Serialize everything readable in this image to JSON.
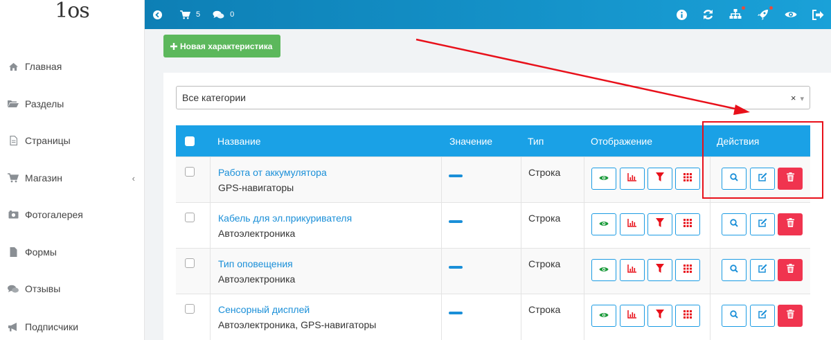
{
  "logo": {
    "text": "1os"
  },
  "sidebar": {
    "items": [
      {
        "label": "Главная",
        "icon": "home-icon"
      },
      {
        "label": "Разделы",
        "icon": "folder-open-icon"
      },
      {
        "label": "Страницы",
        "icon": "file-icon"
      },
      {
        "label": "Магазин",
        "icon": "cart-icon"
      },
      {
        "label": "Фотогалерея",
        "icon": "camera-icon"
      },
      {
        "label": "Формы",
        "icon": "file-solid-icon"
      },
      {
        "label": "Отзывы",
        "icon": "comments-icon"
      },
      {
        "label": "Подписчики",
        "icon": "bullhorn-icon"
      }
    ],
    "shop_chevron": "‹"
  },
  "topbar": {
    "cart_count": "5",
    "comments_count": "0"
  },
  "toolbar": {
    "new_button_label": "Новая характеристика"
  },
  "filter": {
    "selected": "Все категории",
    "clear": "×",
    "caret": "▾"
  },
  "table": {
    "headers": {
      "name": "Название",
      "value": "Значение",
      "type": "Тип",
      "display": "Отображение",
      "actions": "Действия"
    },
    "rows": [
      {
        "name": "Работа от аккумулятора",
        "category": "GPS-навигаторы",
        "type": "Строка"
      },
      {
        "name": "Кабель для эл.прикуривателя",
        "category": "Автоэлектроника",
        "type": "Строка"
      },
      {
        "name": "Тип оповещения",
        "category": "Автоэлектроника",
        "type": "Строка"
      },
      {
        "name": "Сенсорный дисплей",
        "category": "Автоэлектроника, GPS-навигаторы",
        "type": "Строка"
      }
    ]
  },
  "colors": {
    "accent": "#1aa1e6",
    "success": "#5cb85c",
    "danger": "#f0344f",
    "annotation": "#e8101a",
    "link": "#1a8fd8"
  }
}
